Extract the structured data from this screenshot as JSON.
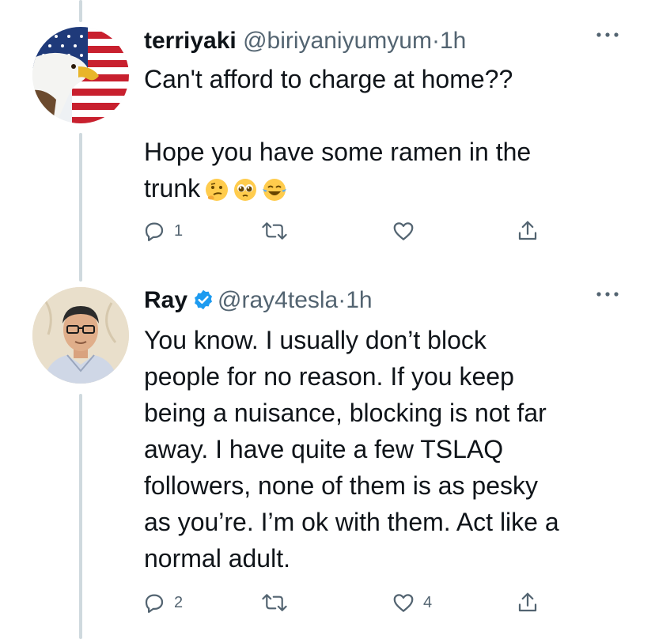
{
  "tweets": [
    {
      "display_name": "terriyaki",
      "handle": "@biriyaniyumyum",
      "separator": "·",
      "time": "1h",
      "verified": false,
      "more_icon": "more-horizontal-icon",
      "body": "Can't afford to charge at home??\n\nHope you have some ramen in the\ntrunk",
      "emojis": [
        "thinking-face",
        "pleading-face",
        "tears-of-joy-face"
      ],
      "actions": {
        "reply_count": "1",
        "retweet_count": "",
        "like_count": ""
      }
    },
    {
      "display_name": "Ray",
      "handle": "@ray4tesla",
      "separator": "·",
      "time": "1h",
      "verified": true,
      "more_icon": "more-horizontal-icon",
      "body": "You know. I usually don’t block\npeople for no reason. If you keep\nbeing a nuisance, blocking is not far\naway. I have quite a few TSLAQ\nfollowers, none of them is as pesky\nas you’re. I’m ok with them. Act like a\nnormal adult.",
      "actions": {
        "reply_count": "2",
        "retweet_count": "",
        "like_count": "4"
      }
    }
  ],
  "colors": {
    "text": "#0f1419",
    "secondary": "#536471",
    "verified": "#1d9bf0",
    "thread_line": "#cfd9de"
  }
}
